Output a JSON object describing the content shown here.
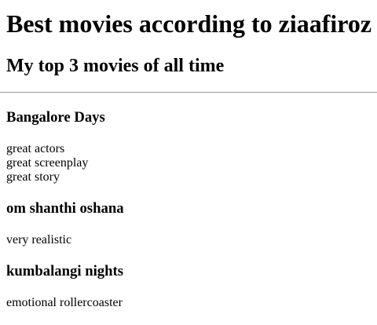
{
  "header": {
    "title": "Best movies according to ziaafiroz",
    "subtitle": "My top 3 movies of all time"
  },
  "movies": [
    {
      "title": "Bangalore Days",
      "lines": [
        "great actors",
        "great screenplay",
        "great story"
      ]
    },
    {
      "title": "om shanthi oshana",
      "lines": [
        "very realistic"
      ]
    },
    {
      "title": "kumbalangi nights",
      "lines": [
        "emotional rollercoaster"
      ]
    }
  ]
}
